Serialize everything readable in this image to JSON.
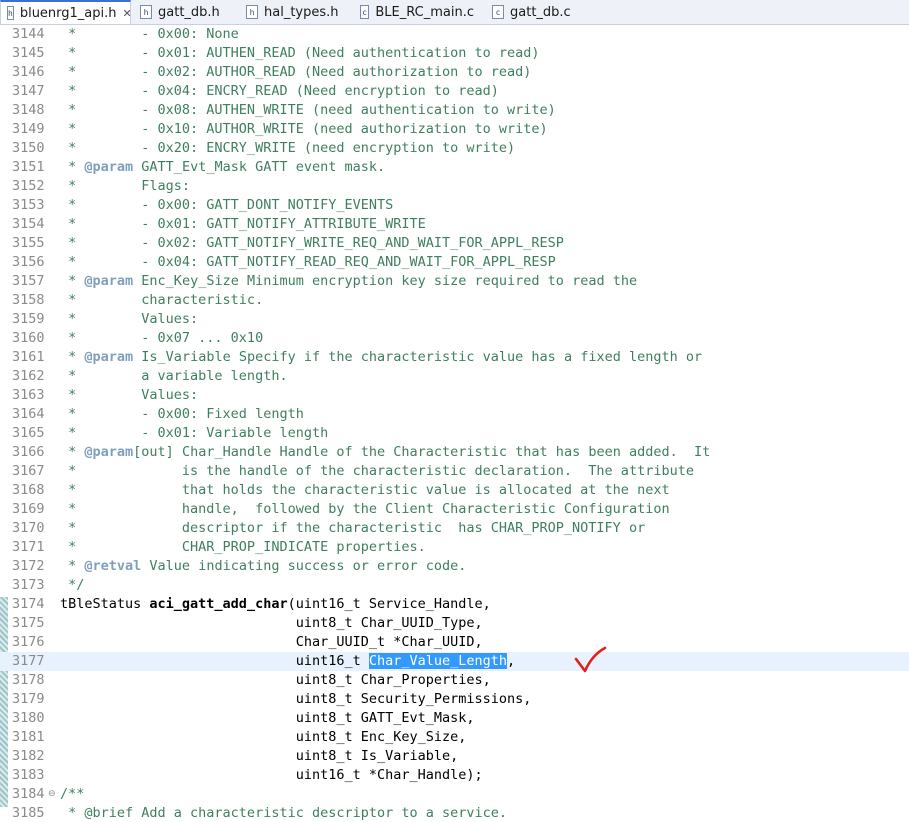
{
  "tabs": [
    {
      "label": "bluenrg1_api.h",
      "icon": "h-file-icon",
      "active": true
    },
    {
      "label": "gatt_db.h",
      "icon": "h-file-icon",
      "active": false
    },
    {
      "label": "hal_types.h",
      "icon": "h-file-icon",
      "active": false
    },
    {
      "label": "BLE_RC_main.c",
      "icon": "c-file-icon",
      "active": false
    },
    {
      "label": "gatt_db.c",
      "icon": "c-file-icon",
      "active": false
    }
  ],
  "code_lines": [
    {
      "n": "3144",
      "text": " *        - 0x00: None"
    },
    {
      "n": "3145",
      "text": " *        - 0x01: AUTHEN_READ (Need authentication to read)"
    },
    {
      "n": "3146",
      "text": " *        - 0x02: AUTHOR_READ (Need authorization to read)"
    },
    {
      "n": "3147",
      "text": " *        - 0x04: ENCRY_READ (Need encryption to read)"
    },
    {
      "n": "3148",
      "text": " *        - 0x08: AUTHEN_WRITE (need authentication to write)"
    },
    {
      "n": "3149",
      "text": " *        - 0x10: AUTHOR_WRITE (need authorization to write)"
    },
    {
      "n": "3150",
      "text": " *        - 0x20: ENCRY_WRITE (need encryption to write)"
    },
    {
      "n": "3151",
      "tag": "@param",
      "text": " GATT_Evt_Mask GATT event mask."
    },
    {
      "n": "3152",
      "text": " *        Flags:"
    },
    {
      "n": "3153",
      "text": " *        - 0x00: GATT_DONT_NOTIFY_EVENTS"
    },
    {
      "n": "3154",
      "text": " *        - 0x01: GATT_NOTIFY_ATTRIBUTE_WRITE"
    },
    {
      "n": "3155",
      "text": " *        - 0x02: GATT_NOTIFY_WRITE_REQ_AND_WAIT_FOR_APPL_RESP"
    },
    {
      "n": "3156",
      "text": " *        - 0x04: GATT_NOTIFY_READ_REQ_AND_WAIT_FOR_APPL_RESP"
    },
    {
      "n": "3157",
      "tag": "@param",
      "text": " Enc_Key_Size Minimum encryption key size required to read the"
    },
    {
      "n": "3158",
      "text": " *        characteristic."
    },
    {
      "n": "3159",
      "text": " *        Values:"
    },
    {
      "n": "3160",
      "text": " *        - 0x07 ... 0x10"
    },
    {
      "n": "3161",
      "tag": "@param",
      "text": " Is_Variable Specify if the characteristic value has a fixed length or"
    },
    {
      "n": "3162",
      "text": " *        a variable length."
    },
    {
      "n": "3163",
      "text": " *        Values:"
    },
    {
      "n": "3164",
      "text": " *        - 0x00: Fixed length"
    },
    {
      "n": "3165",
      "text": " *        - 0x01: Variable length"
    },
    {
      "n": "3166",
      "tag": "@param",
      "text": "[out] Char_Handle Handle of the Characteristic that has been added.  It"
    },
    {
      "n": "3167",
      "text": " *             is the handle of the characteristic declaration.  The attribute"
    },
    {
      "n": "3168",
      "text": " *             that holds the characteristic value is allocated at the next"
    },
    {
      "n": "3169",
      "text": " *             handle,  followed by the Client Characteristic Configuration"
    },
    {
      "n": "3170",
      "text": " *             descriptor if the characteristic  has CHAR_PROP_NOTIFY or"
    },
    {
      "n": "3171",
      "text": " *             CHAR_PROP_INDICATE properties."
    },
    {
      "n": "3172",
      "tag": "@retval",
      "text": " Value indicating success or error code."
    },
    {
      "n": "3173",
      "text": " */"
    },
    {
      "n": "3174",
      "pre": "tBleStatus ",
      "fn": "aci_gatt_add_char",
      "text": "(uint16_t Service_Handle,"
    },
    {
      "n": "3175",
      "text": "                             uint8_t Char_UUID_Type,"
    },
    {
      "n": "3176",
      "text": "                             Char_UUID_t *Char_UUID,"
    },
    {
      "n": "3177",
      "pre": "                             uint16_t ",
      "sel": "Char_Value_Length",
      "text": ","
    },
    {
      "n": "3178",
      "text": "                             uint8_t Char_Properties,"
    },
    {
      "n": "3179",
      "text": "                             uint8_t Security_Permissions,"
    },
    {
      "n": "3180",
      "text": "                             uint8_t GATT_Evt_Mask,"
    },
    {
      "n": "3181",
      "text": "                             uint8_t Enc_Key_Size,"
    },
    {
      "n": "3182",
      "text": "                             uint8_t Is_Variable,"
    },
    {
      "n": "3183",
      "text": "                             uint16_t *Char_Handle);"
    },
    {
      "n": "3184",
      "text": "/**"
    },
    {
      "n": "3185",
      "text": " * @brief Add a characteristic descriptor to a service."
    }
  ],
  "colors": {
    "comment": "#3f7f5f",
    "javadoc_tag": "#7f9fbf",
    "selection": "#3399ff",
    "current_line": "#e8f2fe",
    "annotation": "#e0201a"
  },
  "annotation": "red-checkmark-icon"
}
